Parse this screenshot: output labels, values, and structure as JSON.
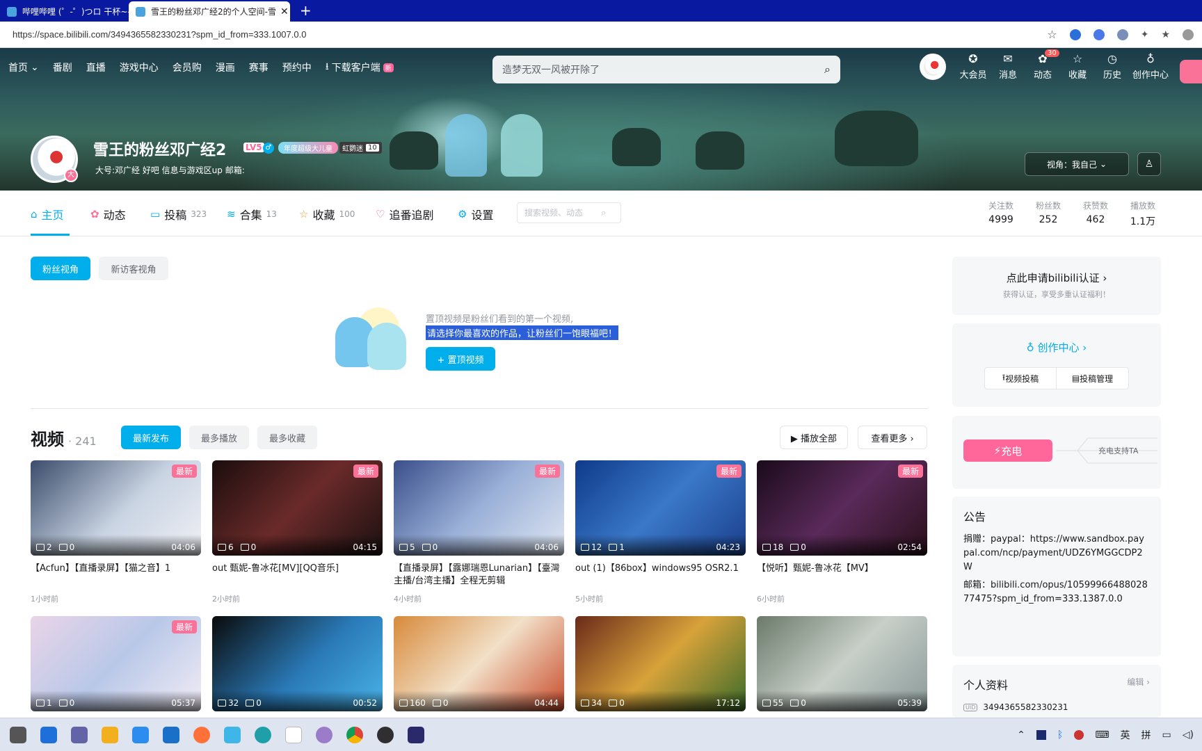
{
  "browser": {
    "tabs": [
      {
        "title": "哔哩哔哩 (゜-゜)つロ 干杯~-bilibi",
        "active": false
      },
      {
        "title": "雪王的粉丝邓广经2的个人空间-雪",
        "active": true
      }
    ],
    "close_glyph": "✕",
    "new_tab_glyph": "+",
    "url": "https://space.bilibili.com/3494365582330231?spm_id_from=333.1007.0.0"
  },
  "header": {
    "nav": [
      {
        "label": "首页",
        "dropdown": true
      },
      {
        "label": "番剧"
      },
      {
        "label": "直播"
      },
      {
        "label": "游戏中心"
      },
      {
        "label": "会员购"
      },
      {
        "label": "漫画"
      },
      {
        "label": "赛事"
      },
      {
        "label": "预约中"
      },
      {
        "label": "下载客户端",
        "badge": "新"
      }
    ],
    "search_placeholder": "造梦无双一风被开除了",
    "right": [
      {
        "label": "大会员",
        "icon": "vip-icon"
      },
      {
        "label": "消息",
        "icon": "mail-icon"
      },
      {
        "label": "动态",
        "icon": "dynamic-icon",
        "count": "30"
      },
      {
        "label": "收藏",
        "icon": "star-icon"
      },
      {
        "label": "历史",
        "icon": "clock-icon"
      },
      {
        "label": "创作中心",
        "icon": "bulb-icon"
      }
    ]
  },
  "profile": {
    "name": "雪王的粉丝邓广经2",
    "level": "LV5",
    "gender_glyph": "♂",
    "medal": "年度超级大儿童",
    "fan_medal_name": "虹鹦迷",
    "fan_medal_level": "10",
    "avatar_badge": "大",
    "sign": "大号:邓广经   好吧  信息与游戏区up 邮箱:",
    "view_switch": "视角：我自己"
  },
  "subnav": {
    "items": [
      {
        "label": "主页",
        "count": "",
        "active": true
      },
      {
        "label": "动态",
        "count": ""
      },
      {
        "label": "投稿",
        "count": "323"
      },
      {
        "label": "合集",
        "count": "13"
      },
      {
        "label": "收藏",
        "count": "100"
      },
      {
        "label": "追番追剧",
        "count": ""
      },
      {
        "label": "设置",
        "count": ""
      }
    ],
    "search_placeholder": "搜索视频、动态",
    "stats": [
      {
        "label": "关注数",
        "value": "4999"
      },
      {
        "label": "粉丝数",
        "value": "252"
      },
      {
        "label": "获赞数",
        "value": "462"
      },
      {
        "label": "播放数",
        "value": "1.1万"
      }
    ]
  },
  "main": {
    "view_chips": [
      "粉丝视角",
      "新访客视角"
    ],
    "pin": {
      "line1": "置顶视频是粉丝们看到的第一个视频,",
      "line2": "请选择你最喜欢的作品，让粉丝们一饱眼福吧！",
      "button": "+ 置顶视频"
    },
    "videos": {
      "title": "视频",
      "count": "· 241",
      "sorts": [
        "最新发布",
        "最多播放",
        "最多收藏"
      ],
      "play_all": "▶ 播放全部",
      "more": "查看更多 ›",
      "new_tag": "最新",
      "items": [
        {
          "title": "【Acfun】【直播录屏】【猫之音】1",
          "plays": "2",
          "danmaku": "0",
          "duration": "04:06",
          "time": "1小时前",
          "newTag": true
        },
        {
          "title": "out 甄妮-鲁冰花[MV][QQ音乐]",
          "plays": "6",
          "danmaku": "0",
          "duration": "04:15",
          "time": "2小时前",
          "newTag": true
        },
        {
          "title": "【直播录屏】【露娜瑞恩Lunarian】【臺灣主播/台湾主播】全程无剪辑",
          "plays": "5",
          "danmaku": "0",
          "duration": "04:06",
          "time": "4小时前",
          "newTag": true
        },
        {
          "title": "out (1)【86box】windows95 OSR2.1",
          "plays": "12",
          "danmaku": "1",
          "duration": "04:23",
          "time": "5小时前",
          "newTag": true
        },
        {
          "title": "【悦听】甄妮-鲁冰花【MV】",
          "plays": "18",
          "danmaku": "0",
          "duration": "02:54",
          "time": "6小时前",
          "newTag": true
        },
        {
          "title": "",
          "plays": "1",
          "danmaku": "0",
          "duration": "05:37",
          "time": "",
          "newTag": true
        },
        {
          "title": "",
          "plays": "32",
          "danmaku": "0",
          "duration": "00:52",
          "time": "",
          "newTag": false
        },
        {
          "title": "",
          "plays": "160",
          "danmaku": "0",
          "duration": "04:44",
          "time": "",
          "newTag": false
        },
        {
          "title": "",
          "plays": "34",
          "danmaku": "0",
          "duration": "17:12",
          "time": "",
          "newTag": false
        },
        {
          "title": "",
          "plays": "55",
          "danmaku": "0",
          "duration": "05:39",
          "time": "",
          "newTag": false
        }
      ]
    }
  },
  "sidebar": {
    "cert_title": "点此申请bilibili认证 ›",
    "cert_sub": "获得认证，享受多重认证福利！",
    "creator_title": "创作中心 ›",
    "creator_btn1": "视频投稿",
    "creator_btn2": "投稿管理",
    "charge_btn": "充电",
    "charge_text": "充电支持TA",
    "notice_title": "公告",
    "notice_line1": "捐赠：paypal：https://www.sandbox.paypal.com/ncp/payment/UDZ6YMGGCDP2W",
    "notice_line2": "邮箱：bilibili.com/opus/1059996648802877475?spm_id_from=333.1387.0.0",
    "profile_title": "个人资料",
    "profile_edit": "编辑 ›",
    "uid_tag": "UID",
    "uid": "3494365582330231"
  },
  "taskbar": {
    "tray": [
      "英",
      "拼"
    ]
  },
  "colors": {
    "accent": "#00aeec",
    "pink": "#fb7299",
    "tab_bar": "#0a1aa0"
  }
}
